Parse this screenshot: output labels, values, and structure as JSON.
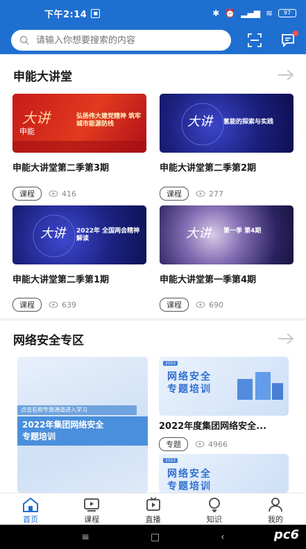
{
  "status_bar": {
    "time": "下午2:14",
    "battery": "97"
  },
  "search": {
    "placeholder": "请输入你想要搜索的内容"
  },
  "section_lecture": {
    "title": "申能大讲堂",
    "cards": [
      {
        "title": "申能大讲堂第二季第3期",
        "tag": "课程",
        "views": "416",
        "thumb_text": "弘扬伟大建党精神 筑牢城市能源防线"
      },
      {
        "title": "申能大讲堂第二季第2期",
        "tag": "课程",
        "views": "277",
        "thumb_text": "氢能的探索与实践"
      },
      {
        "title": "申能大讲堂第二季第1期",
        "tag": "课程",
        "views": "639",
        "thumb_text": "2022年 全国两会精神解读"
      },
      {
        "title": "申能大讲堂第一季第4期",
        "tag": "课程",
        "views": "690",
        "thumb_text": "第一季 第4期"
      }
    ]
  },
  "section_security": {
    "title": "网络安全专区",
    "featured": {
      "ribbon": "点击右侧专题通道进入学习",
      "line1": "2022年集团网络安全",
      "line2": "专题培训"
    },
    "cards": [
      {
        "title": "2022年度集团网络安全...",
        "tag": "专题",
        "views": "4966",
        "thumb_line1": "网络安全",
        "thumb_line2": "专题培训"
      },
      {
        "thumb_line1": "网络安全",
        "thumb_line2": "专题培训"
      }
    ]
  },
  "bottom_nav": [
    {
      "label": "首页",
      "icon": "home-icon",
      "active": true
    },
    {
      "label": "课程",
      "icon": "course-icon",
      "active": false
    },
    {
      "label": "直播",
      "icon": "live-icon",
      "active": false
    },
    {
      "label": "知识",
      "icon": "knowledge-icon",
      "active": false
    },
    {
      "label": "我的",
      "icon": "profile-icon",
      "active": false
    }
  ],
  "watermark": "pc6",
  "colors": {
    "brand": "#1f6fd1",
    "active": "#1f6fd1",
    "badge": "#ff4d4f"
  }
}
